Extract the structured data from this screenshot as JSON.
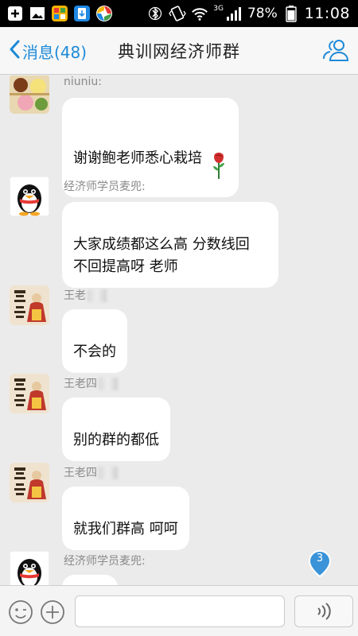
{
  "status_bar": {
    "network": "3G",
    "battery": "78%",
    "time": "11:08"
  },
  "header": {
    "back_label": "消息(48)",
    "title": "典训网经济师群"
  },
  "messages": [
    {
      "sender": "niuniu:",
      "text": "谢谢鲍老师悉心栽培"
    },
    {
      "sender": "经济师学员麦兜:",
      "text": "大家成绩都这么高 分数线回\n不回提高呀 老师"
    },
    {
      "sender": "王老",
      "text": "不会的"
    },
    {
      "sender": "王老四",
      "text": "别的群的都低"
    },
    {
      "sender": "王老四",
      "text": "就我们群高 呵呵"
    },
    {
      "sender": "经济师学员麦兜:",
      "text": ""
    }
  ],
  "unread_count": "3",
  "input": {
    "placeholder": ""
  },
  "colors": {
    "accent": "#1e8ad8",
    "background": "#ebebeb",
    "bubble": "#ffffff"
  },
  "icons": [
    "add-icon",
    "image-icon",
    "app-icon",
    "download-icon",
    "sync-icon",
    "bluetooth-icon",
    "vibrate-icon",
    "wifi-icon",
    "signal-icon",
    "battery-icon",
    "back-chevron-icon",
    "members-icon",
    "rose-icon",
    "emoji-icon",
    "plus-icon",
    "voice-icon"
  ]
}
